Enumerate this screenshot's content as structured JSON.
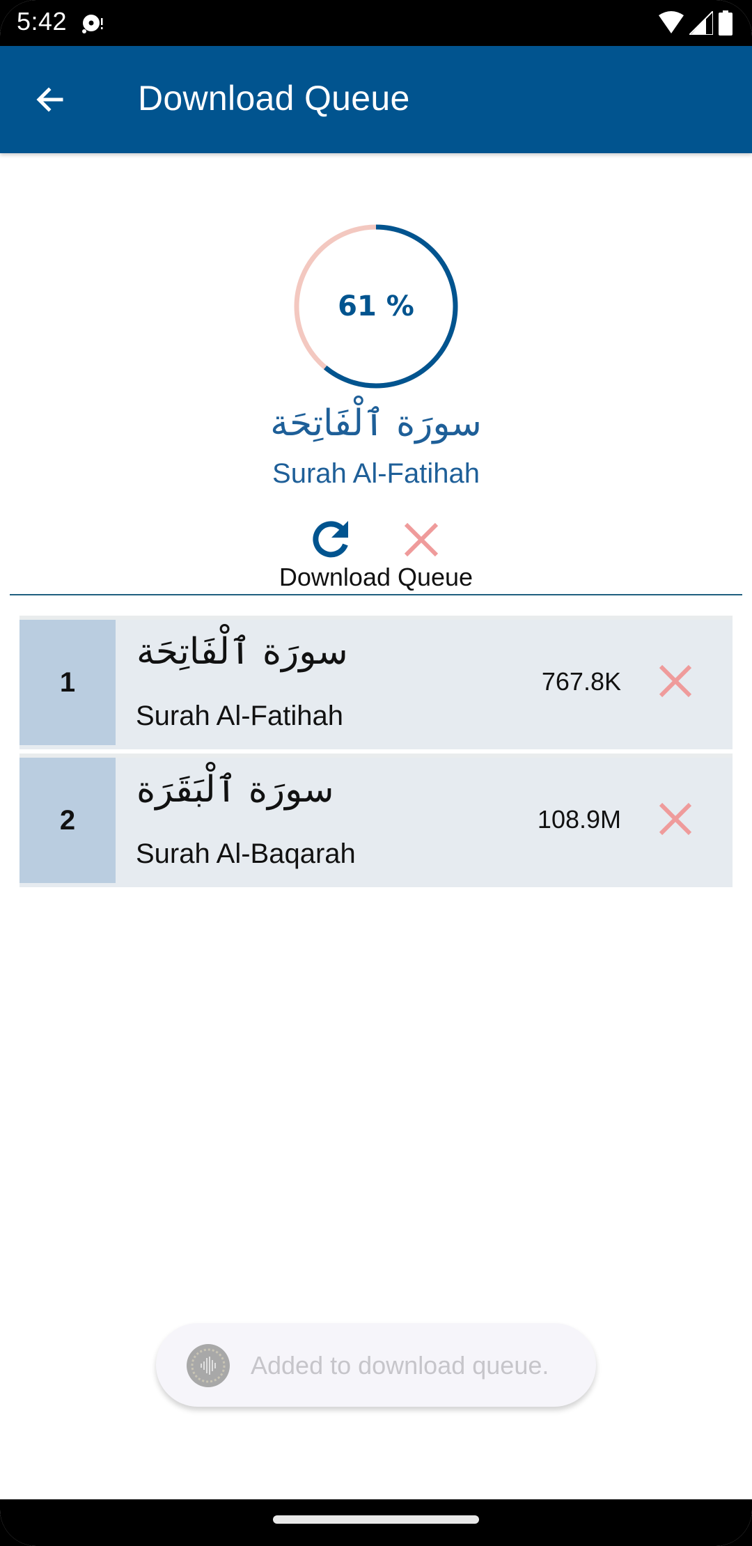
{
  "status_bar": {
    "time": "5:42",
    "notification_icon": "media-notification-icon",
    "icons": [
      "wifi-icon",
      "signal-icon",
      "battery-icon"
    ]
  },
  "app_bar": {
    "title": "Download Queue",
    "back_icon": "arrow-left-icon"
  },
  "current_download": {
    "progress_percent": 61,
    "progress_label": "61 %",
    "arabic_name": "سورَة ٱلْفَاتِحَة",
    "english_name": "Surah Al-Fatihah",
    "retry_icon": "refresh-icon",
    "cancel_icon": "close-icon",
    "section_label": "Download Queue"
  },
  "colors": {
    "primary": "#01548f",
    "progress_track": "#f3c8c0",
    "cancel_red": "#ef9b9b",
    "row_bg": "#e6ebf0",
    "row_num_bg": "#bacde0"
  },
  "queue": [
    {
      "index": "1",
      "arabic_name": "سورَة ٱلْفَاتِحَة",
      "english_name": "Surah Al-Fatihah",
      "size": "767.8K",
      "remove_icon": "close-icon"
    },
    {
      "index": "2",
      "arabic_name": "سورَة ٱلْبَقَرَة",
      "english_name": "Surah Al-Baqarah",
      "size": "108.9M",
      "remove_icon": "close-icon"
    }
  ],
  "toast": {
    "message": "Added to download queue.",
    "icon": "app-logo-icon"
  }
}
